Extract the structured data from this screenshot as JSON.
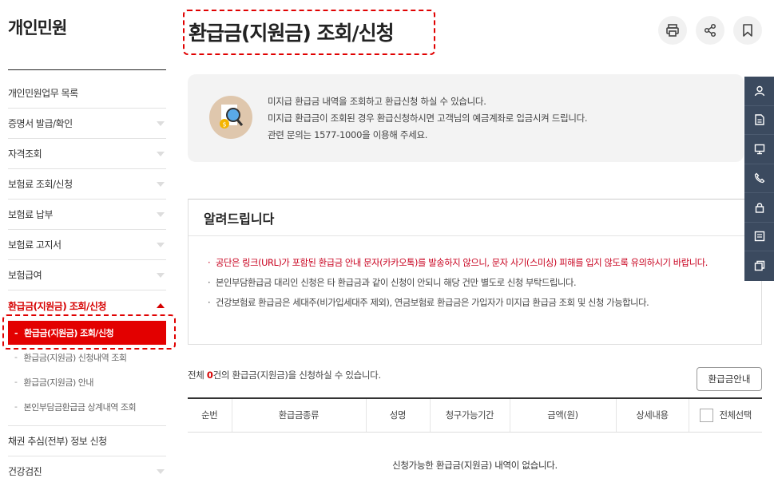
{
  "sidebar": {
    "title": "개인민원",
    "menu": [
      {
        "label": "개인민원업무 목록",
        "caret": false
      },
      {
        "label": "증명서 발급/확인",
        "caret": true
      },
      {
        "label": "자격조회",
        "caret": true
      },
      {
        "label": "보험료 조회/신청",
        "caret": true
      },
      {
        "label": "보험료 납부",
        "caret": true
      },
      {
        "label": "보험료 고지서",
        "caret": true
      },
      {
        "label": "보험급여",
        "caret": true
      }
    ],
    "active_menu": "환급금(지원금) 조회/신청",
    "submenu": [
      "환급금(지원금) 조회/신청",
      "환급금(지원금) 신청내역 조회",
      "환급금(지원금) 안내",
      "본인부담금환급금 상계내역 조회"
    ],
    "menu_after": [
      {
        "label": "채권 추심(전부) 정보 신청",
        "caret": false
      },
      {
        "label": "건강검진",
        "caret": true
      }
    ]
  },
  "page": {
    "title": "환급금(지원금) 조회/신청"
  },
  "top_icons": [
    "printer-icon",
    "share-icon",
    "bookmark-icon"
  ],
  "info": {
    "lines": [
      "미지급 환급금 내역을 조회하고 환급신청 하실 수 있습니다.",
      "미지급 환급금이 조회된 경우 환급신청하시면 고객님의 예금계좌로 입금시켜 드립니다.",
      "관련 문의는 1577-1000을 이용해 주세요."
    ]
  },
  "notice": {
    "title": "알려드립니다",
    "items": [
      "공단은 링크(URL)가 포함된 환급금 안내 문자(카카오톡)를 발송하지 않으니, 문자 사기(스미싱) 피해를 입지 않도록 유의하시기 바랍니다.",
      "본인부담환급금 대리인 신청은 타 환급금과 같이 신청이 안되니 해당 건만 별도로 신청 부탁드립니다.",
      "건강보험료 환급금은 세대주(비가입세대주 제외), 연금보험료 환급금은 가입자가 미지급 환급금 조회 및 신청 가능합니다."
    ]
  },
  "count": {
    "prefix": "전체 ",
    "number": "0",
    "suffix": "건의 환급금(지원금)을 신청하실 수 있습니다."
  },
  "guide_button": "환급금안내",
  "table": {
    "headers": [
      "순번",
      "환급금종류",
      "성명",
      "청구가능기간",
      "금액(원)",
      "상세내용",
      "전체선택"
    ],
    "empty_message": "신청가능한 환급금(지원금) 내역이 없습니다."
  },
  "quickbar": [
    "person-icon",
    "document-icon",
    "monitor-icon",
    "phone-icon",
    "lock-icon",
    "list-icon",
    "copy-icon"
  ],
  "colors": {
    "accent_red": "#e30000",
    "quickbar_bg": "#3b4a5f"
  }
}
